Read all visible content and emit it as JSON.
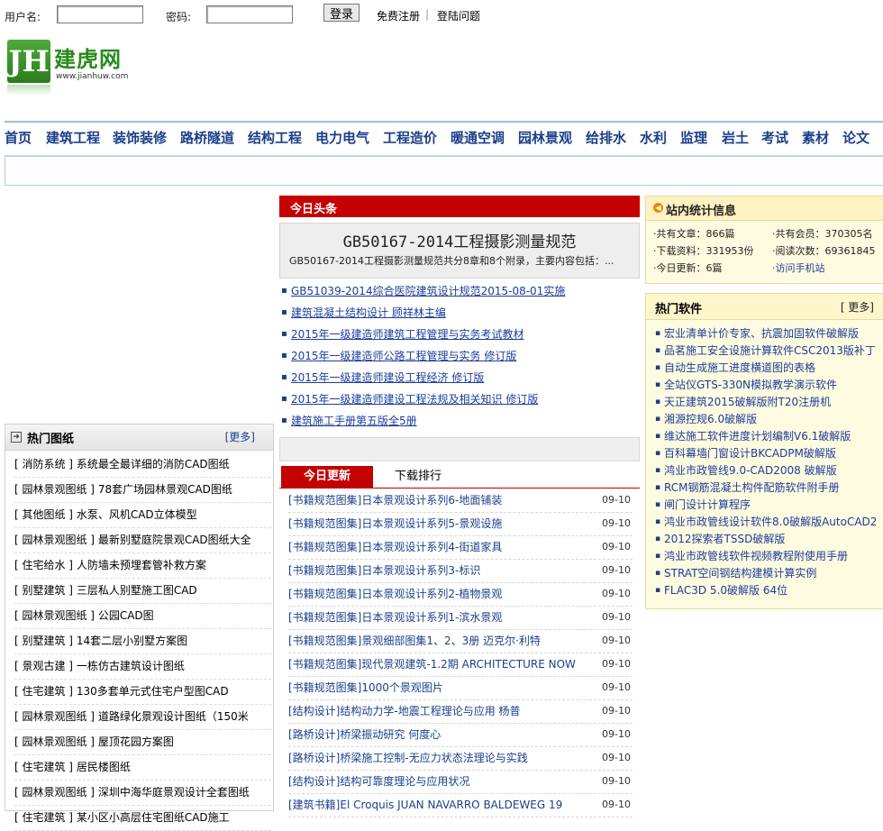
{
  "login": {
    "username_label": "用户名:",
    "password_label": "密码:",
    "login_button": "登录",
    "register_link": "免费注册",
    "separator": "|",
    "help_link": "登陆问题"
  },
  "logo": {
    "mark": "JH",
    "name": "建虎网",
    "url": "www.jianhuw.com"
  },
  "nav": [
    "首页",
    "建筑工程",
    "装饰装修",
    "路桥隧道",
    "结构工程",
    "电力电气",
    "工程造价",
    "暖通空调",
    "园林景观",
    "给排水",
    "水利",
    "监理",
    "岩土",
    "考试",
    "素材",
    "论文"
  ],
  "headlines": {
    "bar_title": "今日头条",
    "title": "GB50167-2014工程摄影测量规范",
    "desc": "GB50167-2014工程摄影测量规范共分8章和8个附录，主要内容包括：..."
  },
  "news": [
    "GB51039-2014综合医院建筑设计规范2015-08-01实施",
    "建筑混凝土结构设计 顾祥林主编",
    "2015年一级建造师建筑工程管理与实务考试教材",
    "2015年一级建造师公路工程管理与实务 修订版",
    "2015年一级建造师建设工程经济 修订版",
    "2015年一级建造师建设工程法规及相关知识 修订版",
    "建筑施工手册第五版全5册"
  ],
  "tabs": {
    "active": "今日更新",
    "other": "下载排行"
  },
  "updates": [
    {
      "cat": "[书籍规范图集]",
      "title": "日本景观设计系列6-地面铺装",
      "date": "09-10"
    },
    {
      "cat": "[书籍规范图集]",
      "title": "日本景观设计系列5-景观设施",
      "date": "09-10"
    },
    {
      "cat": "[书籍规范图集]",
      "title": "日本景观设计系列4-街道家具",
      "date": "09-10"
    },
    {
      "cat": "[书籍规范图集]",
      "title": "日本景观设计系列3-标识",
      "date": "09-10"
    },
    {
      "cat": "[书籍规范图集]",
      "title": "日本景观设计系列2-植物景观",
      "date": "09-10"
    },
    {
      "cat": "[书籍规范图集]",
      "title": "日本景观设计系列1-滨水景观",
      "date": "09-10"
    },
    {
      "cat": "[书籍规范图集]",
      "title": "景观细部图集1、2、3册 迈克尔·利特",
      "date": "09-10"
    },
    {
      "cat": "[书籍规范图集]",
      "title": "现代景观建筑-1.2期 ARCHITECTURE NOW",
      "date": "09-10"
    },
    {
      "cat": "[书籍规范图集]",
      "title": "1000个景观图片",
      "date": "09-10"
    },
    {
      "cat": "[结构设计]",
      "title": "结构动力学-地震工程理论与应用 杨普",
      "date": "09-10"
    },
    {
      "cat": "[路桥设计]",
      "title": "桥梁振动研究 何度心",
      "date": "09-10"
    },
    {
      "cat": "[路桥设计]",
      "title": "桥梁施工控制-无应力状态法理论与实践",
      "date": "09-10"
    },
    {
      "cat": "[结构设计]",
      "title": "结构可靠度理论与应用状况",
      "date": "09-10"
    },
    {
      "cat": "[建筑书籍]",
      "title": "El Croquis JUAN NAVARRO BALDEWEG 19",
      "date": "09-10"
    }
  ],
  "hot_drawings": {
    "title": "热门图纸",
    "more": "[更多]",
    "items": [
      {
        "cat": "[ 消防系统 ]",
        "title": "系统最全最详细的消防CAD图纸"
      },
      {
        "cat": "[ 园林景观图纸 ]",
        "title": "78套广场园林景观CAD图纸"
      },
      {
        "cat": "[ 其他图纸 ]",
        "title": "水泵、风机CAD立体模型"
      },
      {
        "cat": "[ 园林景观图纸 ]",
        "title": "最新别墅庭院景观CAD图纸大全"
      },
      {
        "cat": "[ 住宅给水 ]",
        "title": "人防墙未预埋套管补救方案"
      },
      {
        "cat": "[ 别墅建筑 ]",
        "title": "三层私人别墅施工图CAD"
      },
      {
        "cat": "[ 园林景观图纸 ]",
        "title": "公园CAD图"
      },
      {
        "cat": "[ 别墅建筑 ]",
        "title": "14套二层小别墅方案图"
      },
      {
        "cat": "[ 景观古建 ]",
        "title": "一栋仿古建筑设计图纸"
      },
      {
        "cat": "[ 住宅建筑 ]",
        "title": "130多套单元式住宅户型图CAD"
      },
      {
        "cat": "[ 园林景观图纸 ]",
        "title": "道路绿化景观设计图纸（150米"
      },
      {
        "cat": "[ 园林景观图纸 ]",
        "title": "屋顶花园方案图"
      },
      {
        "cat": "[ 住宅建筑 ]",
        "title": "居民楼图纸"
      },
      {
        "cat": "[ 园林景观图纸 ]",
        "title": "深圳中海华庭景观设计全套图纸"
      },
      {
        "cat": "[ 住宅建筑 ]",
        "title": "某小区小高层住宅图纸CAD施工"
      }
    ]
  },
  "stats": {
    "title": "站内统计信息",
    "articles": "·共有文章：866篇",
    "members": "·共有会员：370305名",
    "downloads": "·下载资料：331953份",
    "views": "·阅读次数：69361845",
    "today": "·今日更新：6篇",
    "mobile": "·访问手机站"
  },
  "hot_software": {
    "title": "热门软件",
    "more": "[ 更多]",
    "items": [
      "宏业清单计价专家、抗震加固软件破解版",
      "品茗施工安全设施计算软件CSC2013版补丁",
      "自动生成施工进度横道图的表格",
      "全站仪GTS-330N模拟教学演示软件",
      "天正建筑2015破解版附T20注册机",
      "湘源控规6.0破解版",
      "维达施工软件进度计划编制V6.1破解版",
      "百科幕墙门窗设计BKCADPM破解版",
      "鸿业市政管线9.0-CAD2008 破解版",
      "RCM钢筋混凝土构件配筋软件附手册",
      "闸门设计计算程序",
      "鸿业市政管线设计软件8.0破解版AutoCAD2",
      "2012探索者TSSD破解版",
      "鸿业市政管线软件视频教程附使用手册",
      "STRAT空间钢结构建模计算实例",
      "FLAC3D 5.0破解版 64位"
    ]
  }
}
